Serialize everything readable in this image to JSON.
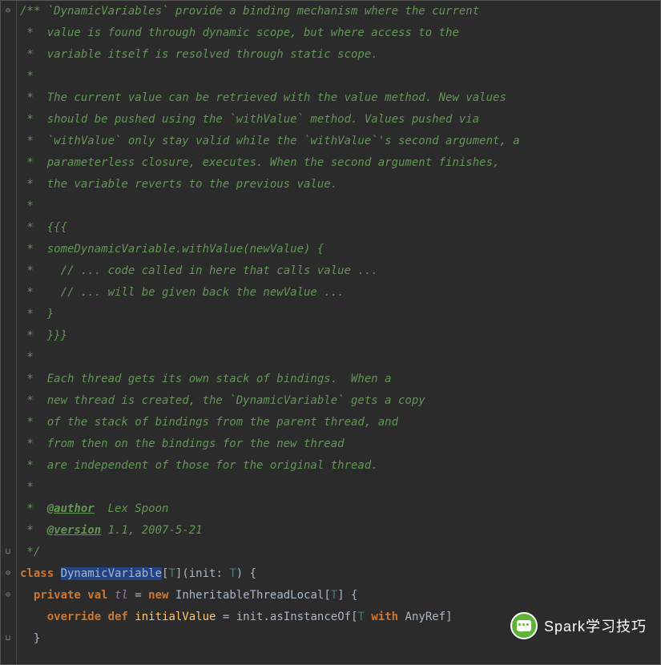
{
  "code": {
    "lines": [
      {
        "spans": [
          {
            "cls": "comment",
            "t": "/** `DynamicVariables` provide a binding mechanism where the current"
          }
        ]
      },
      {
        "spans": [
          {
            "cls": "comment",
            "t": " *  value is found through dynamic scope, but where access to the"
          }
        ]
      },
      {
        "spans": [
          {
            "cls": "comment",
            "t": " *  variable itself is resolved through static scope."
          }
        ]
      },
      {
        "spans": [
          {
            "cls": "comment",
            "t": " *"
          }
        ]
      },
      {
        "spans": [
          {
            "cls": "comment",
            "t": " *  The current value can be retrieved with the value method. New values"
          }
        ]
      },
      {
        "spans": [
          {
            "cls": "comment",
            "t": " *  should be pushed using the `withValue` method. Values pushed via"
          }
        ]
      },
      {
        "spans": [
          {
            "cls": "comment",
            "t": " *  `withValue` only stay valid while the `withValue`'s second argument, a"
          }
        ]
      },
      {
        "spans": [
          {
            "cls": "comment",
            "t": " *  parameterless closure, executes. When the second argument finishes,"
          }
        ]
      },
      {
        "spans": [
          {
            "cls": "comment",
            "t": " *  the variable reverts to the previous value."
          }
        ]
      },
      {
        "spans": [
          {
            "cls": "comment",
            "t": " *"
          }
        ]
      },
      {
        "spans": [
          {
            "cls": "comment",
            "t": " *  {{{"
          }
        ]
      },
      {
        "spans": [
          {
            "cls": "comment",
            "t": " *  someDynamicVariable.withValue(newValue) {"
          }
        ]
      },
      {
        "spans": [
          {
            "cls": "comment",
            "t": " *    // ... code called in here that calls value ..."
          }
        ]
      },
      {
        "spans": [
          {
            "cls": "comment",
            "t": " *    // ... will be given back the newValue ..."
          }
        ]
      },
      {
        "spans": [
          {
            "cls": "comment",
            "t": " *  }"
          }
        ]
      },
      {
        "spans": [
          {
            "cls": "comment",
            "t": " *  }}}"
          }
        ]
      },
      {
        "spans": [
          {
            "cls": "comment",
            "t": " *"
          }
        ]
      },
      {
        "spans": [
          {
            "cls": "comment",
            "t": " *  Each thread gets its own stack of bindings.  When a"
          }
        ]
      },
      {
        "spans": [
          {
            "cls": "comment",
            "t": " *  new thread is created, the `DynamicVariable` gets a copy"
          }
        ]
      },
      {
        "spans": [
          {
            "cls": "comment",
            "t": " *  of the stack of bindings from the parent thread, and"
          }
        ]
      },
      {
        "spans": [
          {
            "cls": "comment",
            "t": " *  from then on the bindings for the new thread"
          }
        ]
      },
      {
        "spans": [
          {
            "cls": "comment",
            "t": " *  are independent of those for the original thread."
          }
        ]
      },
      {
        "spans": [
          {
            "cls": "comment",
            "t": " *"
          }
        ]
      },
      {
        "spans": [
          {
            "cls": "comment",
            "t": " *  "
          },
          {
            "cls": "doc-tag",
            "t": "@author"
          },
          {
            "cls": "comment",
            "t": "  Lex Spoon"
          }
        ]
      },
      {
        "spans": [
          {
            "cls": "comment",
            "t": " *  "
          },
          {
            "cls": "doc-tag",
            "t": "@version"
          },
          {
            "cls": "comment",
            "t": " 1.1, 2007-5-21"
          }
        ]
      },
      {
        "spans": [
          {
            "cls": "comment",
            "t": " */"
          }
        ]
      },
      {
        "spans": [
          {
            "cls": "keyword",
            "t": "class "
          },
          {
            "cls": "selected",
            "t": "DynamicVariable"
          },
          {
            "cls": "paren",
            "t": "["
          },
          {
            "cls": "tparam",
            "t": "T"
          },
          {
            "cls": "paren",
            "t": "]("
          },
          {
            "cls": "ident",
            "t": "init"
          },
          {
            "cls": "plain",
            "t": ": "
          },
          {
            "cls": "tparam",
            "t": "T"
          },
          {
            "cls": "paren",
            "t": ") {"
          }
        ]
      },
      {
        "spans": [
          {
            "cls": "plain",
            "t": "  "
          },
          {
            "cls": "keyword",
            "t": "private val "
          },
          {
            "cls": "field",
            "t": "tl"
          },
          {
            "cls": "plain",
            "t": " = "
          },
          {
            "cls": "keyword",
            "t": "new "
          },
          {
            "cls": "ident",
            "t": "InheritableThreadLocal"
          },
          {
            "cls": "paren",
            "t": "["
          },
          {
            "cls": "tparam",
            "t": "T"
          },
          {
            "cls": "paren",
            "t": "] {"
          }
        ]
      },
      {
        "spans": [
          {
            "cls": "plain",
            "t": "    "
          },
          {
            "cls": "keyword",
            "t": "override def "
          },
          {
            "cls": "method",
            "t": "initialValue"
          },
          {
            "cls": "plain",
            "t": " = "
          },
          {
            "cls": "ident",
            "t": "init"
          },
          {
            "cls": "plain",
            "t": "."
          },
          {
            "cls": "ident",
            "t": "asInstanceOf"
          },
          {
            "cls": "paren",
            "t": "["
          },
          {
            "cls": "tparam",
            "t": "T"
          },
          {
            "cls": "plain",
            "t": " "
          },
          {
            "cls": "keyword",
            "t": "with"
          },
          {
            "cls": "plain",
            "t": " "
          },
          {
            "cls": "ident",
            "t": "AnyRef"
          },
          {
            "cls": "paren",
            "t": "]"
          }
        ]
      },
      {
        "spans": [
          {
            "cls": "plain",
            "t": "  }"
          }
        ]
      }
    ]
  },
  "foldMarkers": [
    {
      "lineIdx": 0,
      "glyph": "⊖"
    },
    {
      "lineIdx": 25,
      "glyph": "⊔"
    },
    {
      "lineIdx": 26,
      "glyph": "⊖"
    },
    {
      "lineIdx": 27,
      "glyph": "⊖"
    },
    {
      "lineIdx": 29,
      "glyph": "⊔"
    }
  ],
  "watermark": {
    "text": "Spark学习技巧"
  }
}
